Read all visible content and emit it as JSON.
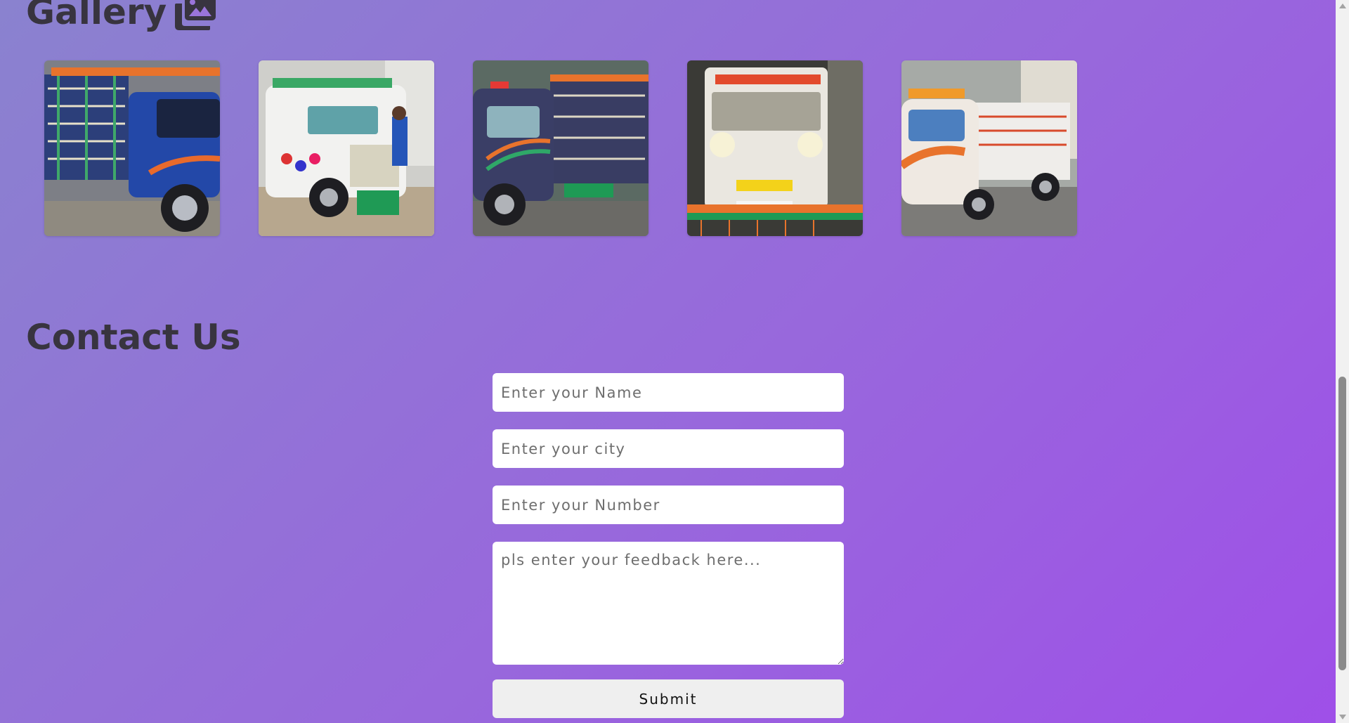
{
  "gallery": {
    "title": "Gallery",
    "icon": "images-icon",
    "images": [
      {
        "name": "gallery-image-1",
        "alt": "blue decorated truck side view"
      },
      {
        "name": "gallery-image-2",
        "alt": "white decorated pickup truck"
      },
      {
        "name": "gallery-image-3",
        "alt": "dark blue decorated truck"
      },
      {
        "name": "gallery-image-4",
        "alt": "white truck front decorated"
      },
      {
        "name": "gallery-image-5",
        "alt": "white and orange pickup truck"
      }
    ]
  },
  "contact": {
    "title": "Contact Us",
    "name_placeholder": "Enter your Name",
    "city_placeholder": "Enter your city",
    "number_placeholder": "Enter your Number",
    "feedback_placeholder": "pls enter your feedback here...",
    "submit_label": "Submit"
  },
  "colors": {
    "background_start": "#8a82cf",
    "background_end": "#9f4fe8",
    "heading": "#38343f"
  }
}
